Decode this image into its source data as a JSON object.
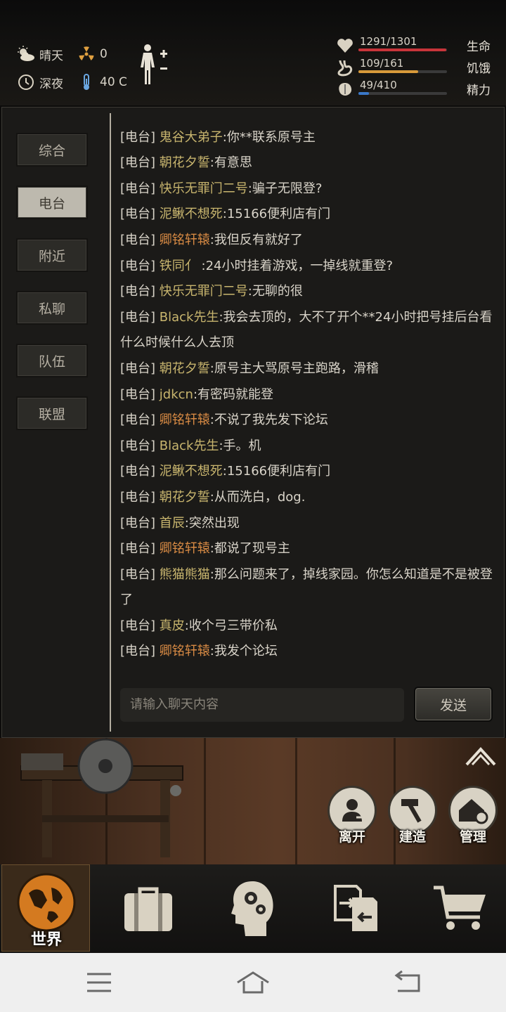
{
  "status": {
    "weather": "晴天",
    "radiation": "0",
    "time_of_day": "深夜",
    "temperature": "40 C"
  },
  "vitals": [
    {
      "key": "life",
      "label": "生命",
      "value": "1291/1301",
      "current": 1291,
      "max": 1301,
      "color": "#c8343a",
      "icon": "heart-icon"
    },
    {
      "key": "hunger",
      "label": "饥饿",
      "value": "109/161",
      "current": 109,
      "max": 161,
      "color": "#d89a3a",
      "icon": "stomach-icon"
    },
    {
      "key": "energy",
      "label": "精力",
      "value": "49/410",
      "current": 49,
      "max": 410,
      "color": "#3a78c8",
      "icon": "brain-icon"
    }
  ],
  "tabs": [
    {
      "label": "综合",
      "active": false
    },
    {
      "label": "电台",
      "active": true
    },
    {
      "label": "附近",
      "active": false
    },
    {
      "label": "私聊",
      "active": false
    },
    {
      "label": "队伍",
      "active": false
    },
    {
      "label": "联盟",
      "active": false
    }
  ],
  "chat": {
    "channel": "[电台]",
    "messages": [
      {
        "name": "泥鳅不想死",
        "text": ":15166便利店有门",
        "orange": false
      },
      {
        "name": "鬼谷大弟子",
        "text": ":你**联系原号主",
        "orange": false
      },
      {
        "name": "朝花夕誓",
        "text": ":有意思",
        "orange": false
      },
      {
        "name": "快乐无罪门二号",
        "text": ":骗子无限登?",
        "orange": false
      },
      {
        "name": "泥鳅不想死",
        "text": ":15166便利店有门",
        "orange": false
      },
      {
        "name": "卿铭轩辕",
        "text": ":我但反有就好了",
        "orange": true
      },
      {
        "name": "铁同亻",
        "text": " :24小时挂着游戏，一掉线就重登?",
        "orange": false
      },
      {
        "name": "快乐无罪门二号",
        "text": ":无聊的很",
        "orange": false
      },
      {
        "name": "Black先生",
        "text": ":我会去顶的，大不了开个**24小时把号挂后台看什么时候什么人去顶",
        "orange": false
      },
      {
        "name": "朝花夕誓",
        "text": ":原号主大骂原号主跑路，滑稽",
        "orange": false
      },
      {
        "name": "jdkcn",
        "text": ":有密码就能登",
        "orange": false
      },
      {
        "name": "卿铭轩辕",
        "text": ":不说了我先发下论坛",
        "orange": true
      },
      {
        "name": "Black先生",
        "text": ":手。机",
        "orange": false
      },
      {
        "name": "泥鳅不想死",
        "text": ":15166便利店有门",
        "orange": false
      },
      {
        "name": "朝花夕誓",
        "text": ":从而洗白，dog.",
        "orange": false
      },
      {
        "name": "首辰",
        "text": ":突然出现",
        "orange": false
      },
      {
        "name": "卿铭轩辕",
        "text": ":都说了现号主",
        "orange": true
      },
      {
        "name": "熊猫熊猫",
        "text": ":那么问题来了，掉线家园。你怎么知道是不是被登了",
        "orange": false
      },
      {
        "name": "真皮",
        "text": ":收个弓三带价私",
        "orange": false
      },
      {
        "name": "卿铭轩辕",
        "text": ":我发个论坛",
        "orange": true
      }
    ],
    "input_placeholder": "请输入聊天内容",
    "send_label": "发送"
  },
  "actions": [
    {
      "label": "离开",
      "icon": "person-leave-icon"
    },
    {
      "label": "建造",
      "icon": "hammer-build-icon"
    },
    {
      "label": "管理",
      "icon": "house-gear-icon"
    }
  ],
  "bottom_nav": {
    "world_label": "世界",
    "items": [
      "world-globe-icon",
      "suitcase-icon",
      "head-gears-icon",
      "exchange-icon",
      "cart-icon"
    ]
  }
}
